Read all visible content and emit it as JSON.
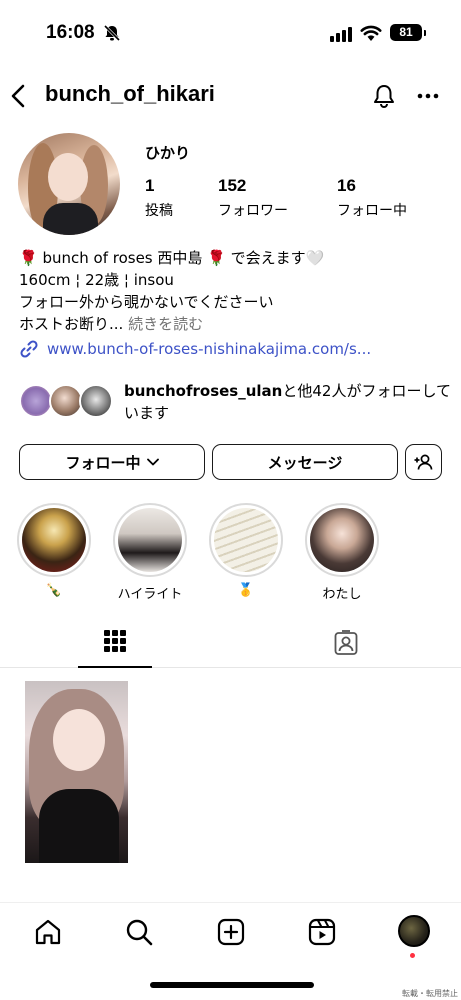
{
  "status_bar": {
    "time": "16:08",
    "battery": "81"
  },
  "header": {
    "username": "bunch_of_hikari"
  },
  "profile": {
    "display_name": "ひかり",
    "stats": [
      {
        "num": "1",
        "label": "投稿"
      },
      {
        "num": "152",
        "label": "フォロワー"
      },
      {
        "num": "16",
        "label": "フォロー中"
      }
    ],
    "bio": {
      "line1_a": "🌹",
      "line1_b": " bunch of roses 西中島 ",
      "line1_c": "🌹",
      "line1_d": " で会えます",
      "line1_e": "🤍",
      "line2": "160cm ¦ 22歳 ¦ insou",
      "line3": "フォロー外から覗かないでくださーい",
      "line4": "ホストお断り...",
      "more": " 続きを読む"
    },
    "link": "www.bunch-of-roses-nishinakajima.com/s...",
    "followed_by": {
      "name": "bunchofroses_ulan",
      "rest": "と他42人がフォローしています"
    }
  },
  "buttons": {
    "following": "フォロー中",
    "message": "メッセージ"
  },
  "highlights": [
    {
      "label": "🍾"
    },
    {
      "label": "ハイライト"
    },
    {
      "label": "🥇"
    },
    {
      "label": "わたし"
    }
  ],
  "footer": {
    "watermark": "転載・転用禁止"
  },
  "colors": {
    "link": "#3d52c7",
    "rose": "#c4102a",
    "notification_dot": "#ff3040"
  }
}
